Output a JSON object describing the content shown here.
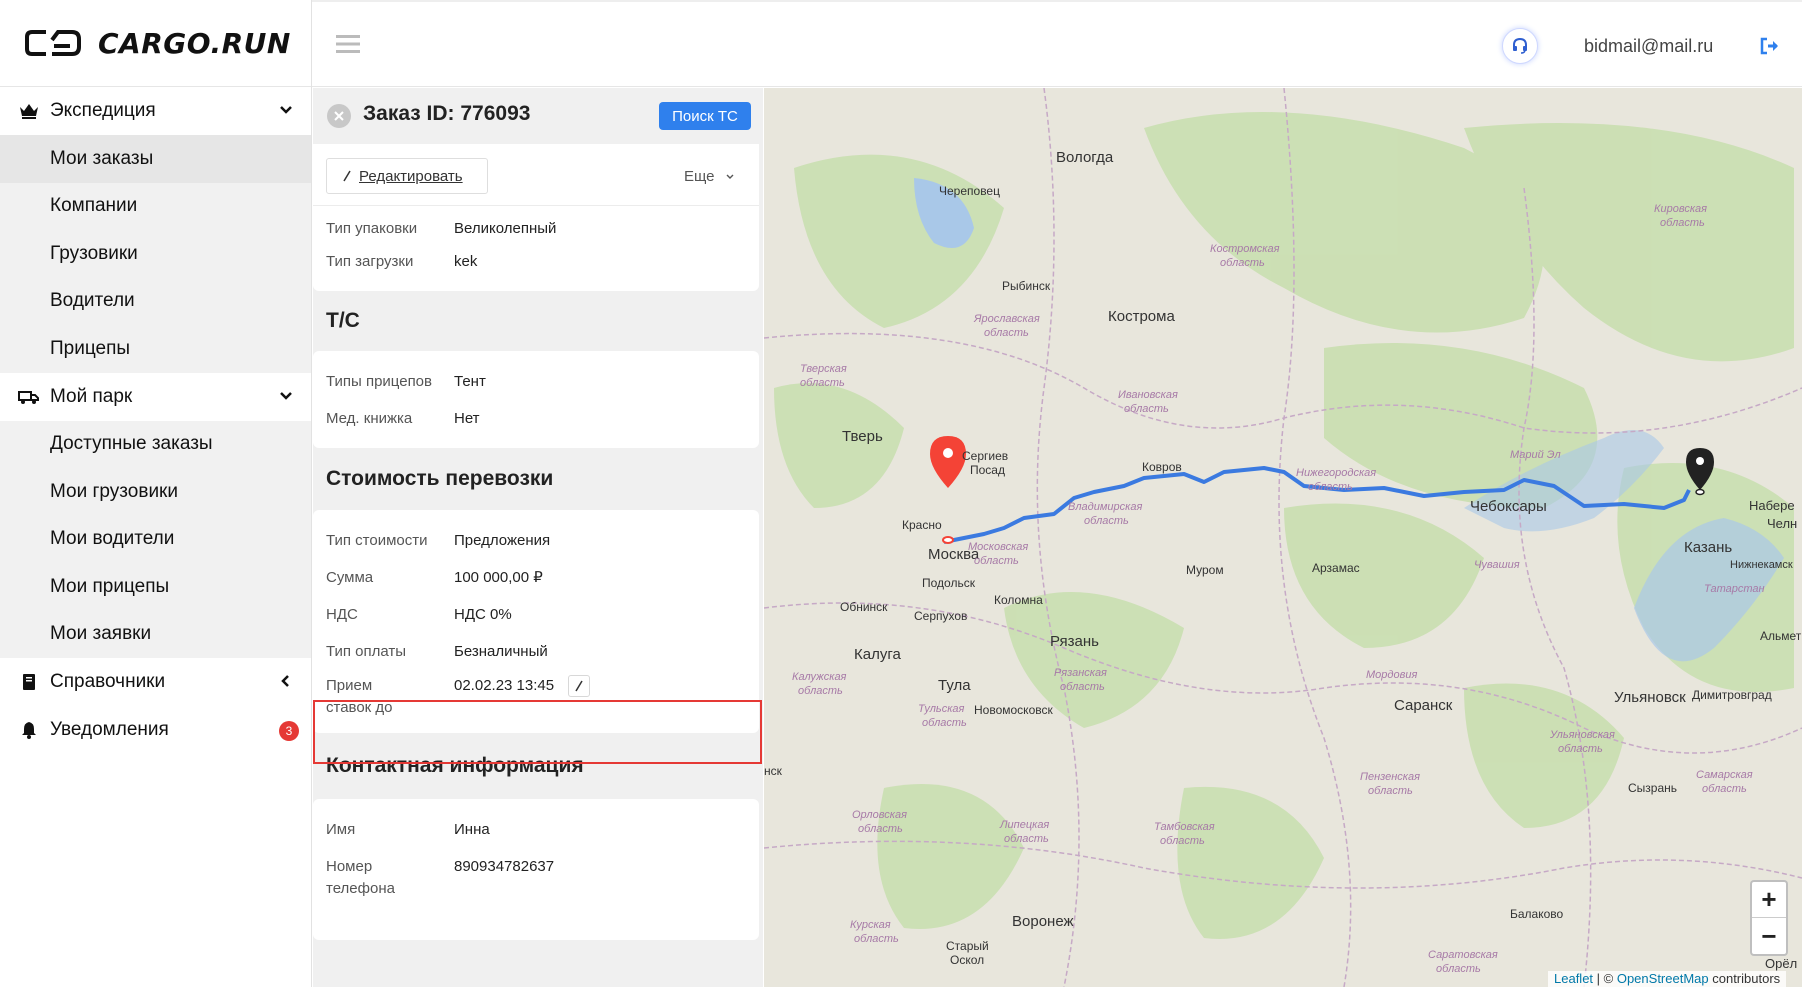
{
  "brand": {
    "name": "CARGO.RUN"
  },
  "sidebar": {
    "groups": [
      {
        "label": "Экспедиция",
        "items": [
          "Мои заказы",
          "Компании",
          "Грузовики",
          "Водители",
          "Прицепы"
        ]
      },
      {
        "label": "Мой парк",
        "items": [
          "Доступные заказы",
          "Мои грузовики",
          "Мои водители",
          "Мои прицепы",
          "Мои заявки"
        ]
      },
      {
        "label": "Справочники"
      },
      {
        "label": "Уведомления",
        "badge": "3"
      }
    ],
    "active_item": "Мои заказы"
  },
  "header": {
    "email": "bidmail@mail.ru"
  },
  "order": {
    "title": "Заказ ID: 776093",
    "search_button": "Поиск ТС",
    "edit_button": "Редактировать",
    "more_button": "Еще",
    "cargo": [
      {
        "k": "Тип упаковки",
        "v": "Великолепный"
      },
      {
        "k": "Тип загрузки",
        "v": "kek"
      }
    ],
    "ts_title": "Т/С",
    "ts": [
      {
        "k": "Типы прицепов",
        "v": "Тент"
      },
      {
        "k": "Мед. книжка",
        "v": "Нет"
      }
    ],
    "cost_title": "Стоимость перевозки",
    "cost": [
      {
        "k": "Тип стоимости",
        "v": "Предложения"
      },
      {
        "k": "Сумма",
        "v": "100 000,00 ₽"
      },
      {
        "k": "НДС",
        "v": "НДС 0%"
      },
      {
        "k": "Тип оплаты",
        "v": "Безналичный"
      }
    ],
    "bids_until_label_1": "Прием",
    "bids_until_label_2": "ставок до",
    "bids_until_value": "02.02.23 13:45",
    "contact_title": "Контактная информация",
    "contact": [
      {
        "k": "Имя",
        "v": "Инна"
      },
      {
        "k": "Номер телефона",
        "v": "890934782637"
      }
    ],
    "contact_phone_label_1": "Номер",
    "contact_phone_label_2": "телефона"
  },
  "map": {
    "cities": [
      "Вологда",
      "Череповец",
      "Рыбинск",
      "Кострома",
      "Тверь",
      "Сергиев Посад",
      "Ковров",
      "Красногорск",
      "Москва",
      "Подольск",
      "Коломна",
      "Муром",
      "Арзамас",
      "Чебоксары",
      "Казань",
      "Обнинск",
      "Серпухов",
      "Калуга",
      "Рязань",
      "Тула",
      "Новомосковск",
      "Саранск",
      "Ульяновск",
      "Димитровград",
      "Сызрань",
      "Воронеж",
      "Балаково",
      "Старый Оскол",
      "Набережные Челны",
      "Нижнекамск",
      "Альметьевск",
      "Орёл",
      "Брянск",
      "Орёл"
    ],
    "regions": [
      "Костромская область",
      "Ярославская область",
      "Тверская область",
      "Ивановская область",
      "Нижегородская область",
      "Владимирская область",
      "Московская область",
      "Марий Эл",
      "Чувашия",
      "Татарстан",
      "Кировская область",
      "Калужская область",
      "Рязанская область",
      "Тульская область",
      "Мордовия",
      "Пензенская область",
      "Ульяновская область",
      "Самарская область",
      "Орловская область",
      "Липецкая область",
      "Тамбовская область",
      "Курская область",
      "Саратовская область"
    ],
    "labels": {
      "vologda": "Вологда",
      "cherepovets": "Череповец",
      "rybinsk": "Рыбинск",
      "kostroma": "Кострома",
      "tver": "Тверь",
      "sergiev": "Сергиев",
      "posad": "Посад",
      "kovrov": "Ковров",
      "krasno": "Красно",
      "moscow": "Москва",
      "podolsk": "Подольск",
      "kolomna": "Коломна",
      "murom": "Муром",
      "arzamas": "Арзамас",
      "cheboksary": "Чебоксары",
      "kazan": "Казань",
      "obninsk": "Обнинск",
      "serpukhov": "Серпухов",
      "kaluga": "Калуга",
      "ryazan": "Рязань",
      "tula": "Тула",
      "novomoskovsk": "Новомосковск",
      "saransk": "Саранск",
      "ulyanovsk": "Ульяновск",
      "dimitrovgrad": "Димитровград",
      "syzran": "Сызрань",
      "voronezh": "Воронеж",
      "balakovo": "Балаково",
      "stary": "Старый",
      "oskol": "Оскол",
      "nabere": "Набере",
      "chel": "Челн",
      "nizhnekamsk": "Нижнекамск",
      "almet": "Альметь",
      "oryol": "Орёл",
      "nsk": "нск",
      "r_kostroma_1": "Костромская",
      "r_kostroma_2": "область",
      "r_yaroslavl_1": "Ярославская",
      "r_yaroslavl_2": "область",
      "r_tver_1": "Тверская",
      "r_tver_2": "область",
      "r_ivanovo_1": "Ивановская",
      "r_ivanovo_2": "область",
      "r_nizhny_1": "Нижегородская",
      "r_nizhny_2": "область",
      "r_vladimir_1": "Владимирская",
      "r_vladimir_2": "область",
      "r_moscow_1": "Московская",
      "r_moscow_2": "область",
      "r_mariel": "Марий Эл",
      "r_chuvash": "Чувашия",
      "r_tatar": "Татарстан",
      "r_kirov_1": "Кировская",
      "r_kirov_2": "область",
      "r_kaluga_1": "Калужская",
      "r_kaluga_2": "область",
      "r_ryazan_1": "Рязанская",
      "r_ryazan_2": "область",
      "r_tula_1": "Тульская",
      "r_tula_2": "область",
      "r_mordovia": "Мордовия",
      "r_penza_1": "Пензенская",
      "r_penza_2": "область",
      "r_ulyanovsk_1": "Ульяновская",
      "r_ulyanovsk_2": "область",
      "r_samara_1": "Самарская",
      "r_samara_2": "область",
      "r_oryol_1": "Орловская",
      "r_oryol_2": "область",
      "r_lipetsk_1": "Липецкая",
      "r_lipetsk_2": "область",
      "r_tambov_1": "Тамбовская",
      "r_tambov_2": "область",
      "r_kursk_1": "Курская",
      "r_kursk_2": "область",
      "r_saratov_1": "Саратовская",
      "r_saratov_2": "область"
    },
    "zoom_in": "+",
    "zoom_out": "−",
    "attribution_leaflet": "Leaflet",
    "attribution_sep": " | © ",
    "attribution_osm": "OpenStreetMap",
    "attribution_tail": " contributors"
  },
  "colors": {
    "accent": "#2f80ed",
    "route": "#3b7ae0",
    "origin_marker": "#f44336",
    "dest_marker": "#222222",
    "highlight": "#e53935",
    "badge": "#e53935"
  },
  "icons": [
    "crown-icon",
    "truck-icon",
    "book-icon",
    "bell-icon",
    "chevron-down-icon",
    "chevron-left-icon",
    "menu-icon",
    "support-icon",
    "logout-icon",
    "close-icon",
    "pencil-icon",
    "map-pin-icon"
  ]
}
